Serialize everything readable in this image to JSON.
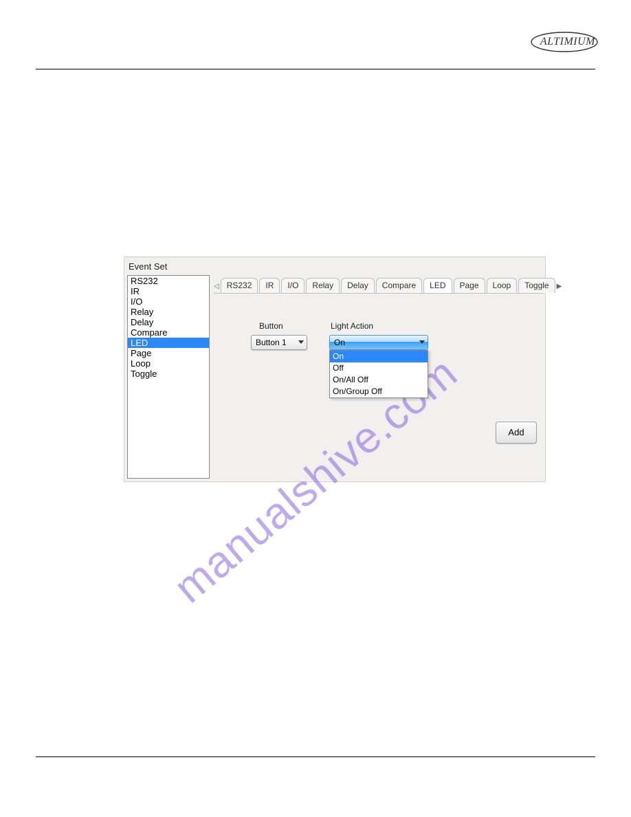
{
  "brand": "ALTIMIUM",
  "watermark": "manualshive.com",
  "panel": {
    "title": "Event Set",
    "listItems": [
      "RS232",
      "IR",
      "I/O",
      "Relay",
      "Delay",
      "Compare",
      "LED",
      "Page",
      "Loop",
      "Toggle"
    ],
    "selectedListIndex": 6,
    "tabs": [
      "RS232",
      "IR",
      "I/O",
      "Relay",
      "Delay",
      "Compare",
      "LED",
      "Page",
      "Loop",
      "Toggle"
    ],
    "activeTabIndex": 6,
    "form": {
      "buttonLabel": "Button",
      "lightActionLabel": "Light Action",
      "buttonValue": "Button 1",
      "lightActionValue": "On",
      "lightActionOptions": [
        "On",
        "Off",
        "On/All Off",
        "On/Group Off"
      ],
      "lightActionSelectedIndex": 0,
      "addButtonLabel": "Add"
    }
  }
}
